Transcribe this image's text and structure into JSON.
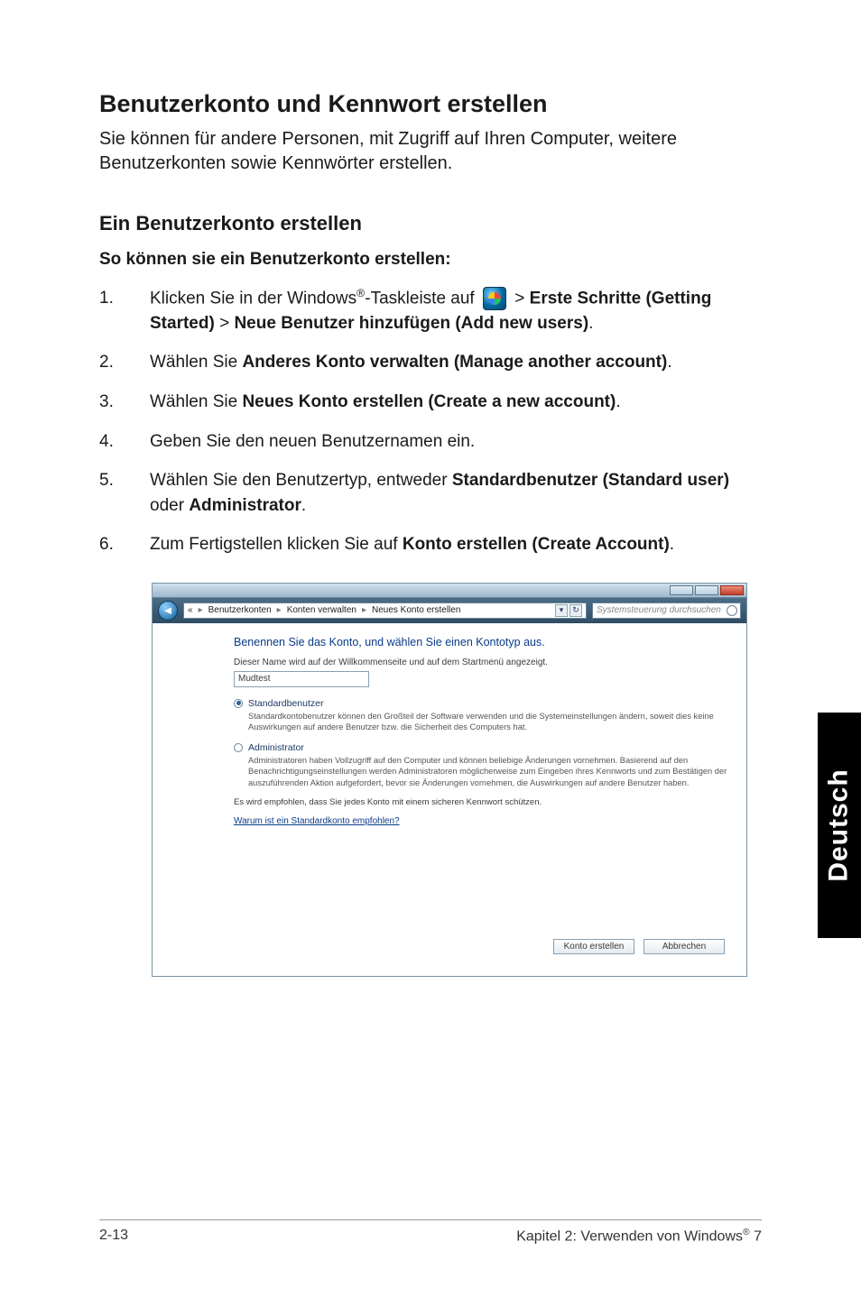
{
  "section": {
    "title": "Benutzerkonto und Kennwort erstellen",
    "intro": "Sie können für andere Personen, mit Zugriff auf Ihren Computer, weitere Benutzerkonten sowie Kennwörter erstellen."
  },
  "sub": {
    "title": "Ein Benutzerkonto erstellen",
    "leadin": "So können sie ein Benutzerkonto erstellen:"
  },
  "steps": {
    "s1": {
      "num": "1.",
      "pre": "Klicken Sie in der Windows",
      "sup": "®",
      "mid": "-Taskleiste auf ",
      "gt1": " > ",
      "b1": "Erste Schritte (Getting Started)",
      "gt2": " > ",
      "b2": "Neue Benutzer hinzufügen (Add new users)",
      "post": "."
    },
    "s2": {
      "num": "2.",
      "pre": "Wählen Sie ",
      "b": "Anderes Konto verwalten (Manage another account)",
      "post": "."
    },
    "s3": {
      "num": "3.",
      "pre": "Wählen Sie ",
      "b": "Neues Konto erstellen (Create a new account)",
      "post": "."
    },
    "s4": {
      "num": "4.",
      "text": "Geben Sie den neuen Benutzernamen ein."
    },
    "s5": {
      "num": "5.",
      "pre": "Wählen Sie den Benutzertyp, entweder ",
      "b1": "Standardbenutzer (Standard user)",
      "mid": " oder ",
      "b2": "Administrator",
      "post": "."
    },
    "s6": {
      "num": "6.",
      "pre": "Zum Fertigstellen klicken Sie auf ",
      "b": "Konto erstellen (Create Account)",
      "post": "."
    }
  },
  "window": {
    "breadcrumb": {
      "root_icon": "«",
      "seg1": "Benutzerkonten",
      "seg2": "Konten verwalten",
      "seg3": "Neues Konto erstellen"
    },
    "search_placeholder": "Systemsteuerung durchsuchen",
    "heading": "Benennen Sie das Konto, und wählen Sie einen Kontotyp aus.",
    "desc": "Dieser Name wird auf der Willkommenseite und auf dem Startmenü angezeigt.",
    "input_value": "Mudtest",
    "opt_std": {
      "label": "Standardbenutzer",
      "exp": "Standardkontobenutzer können den Großteil der Software verwenden und die Systemeinstellungen ändern, soweit dies keine Auswirkungen auf andere Benutzer bzw. die Sicherheit des Computers hat."
    },
    "opt_admin": {
      "label": "Administrator",
      "exp": "Administratoren haben Vollzugriff auf den Computer und können beliebige Änderungen vornehmen. Basierend auf den Benachrichtigungseinstellungen werden Administratoren möglicherweise zum Eingeben ihres Kennworts und zum Bestätigen der auszuführenden Aktion aufgefordert, bevor sie Änderungen vornehmen, die Auswirkungen auf andere Benutzer haben."
    },
    "reco": "Es wird empfohlen, dass Sie jedes Konto mit einem sicheren Kennwort schützen.",
    "why": "Warum ist ein Standardkonto empfohlen?",
    "btn_create": "Konto erstellen",
    "btn_cancel": "Abbrechen"
  },
  "sidebar_tab": "Deutsch",
  "footer": {
    "left": "2-13",
    "right_pre": "Kapitel 2: Verwenden von Windows",
    "right_sup": "®",
    "right_post": " 7"
  }
}
